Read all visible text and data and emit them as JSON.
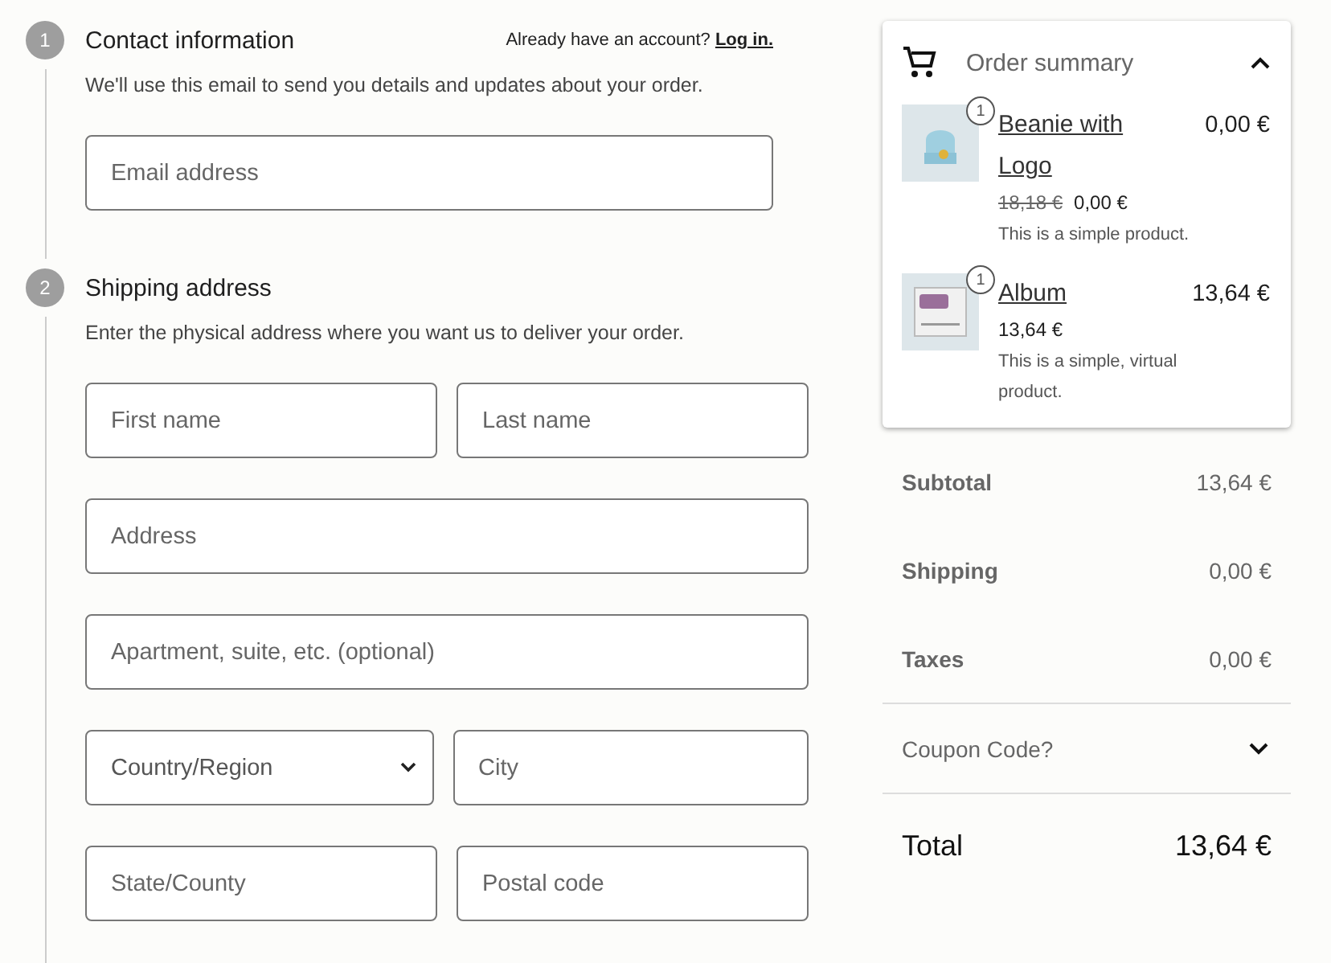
{
  "steps": [
    {
      "number": "1",
      "title": "Contact information",
      "aside_text": "Already have an account?",
      "aside_link": "Log in.",
      "description": "We'll use this email to send you details and updates about your order.",
      "rows": [
        [
          {
            "kind": "text",
            "placeholder": "Email address"
          }
        ]
      ]
    },
    {
      "number": "2",
      "title": "Shipping address",
      "description": "Enter the physical address where you want us to deliver your order.",
      "rows": [
        [
          {
            "kind": "text",
            "placeholder": "First name"
          },
          {
            "kind": "text",
            "placeholder": "Last name"
          }
        ],
        [
          {
            "kind": "text",
            "placeholder": "Address"
          }
        ],
        [
          {
            "kind": "text",
            "placeholder": "Apartment, suite, etc. (optional)"
          }
        ],
        [
          {
            "kind": "select",
            "placeholder": "Country/Region"
          },
          {
            "kind": "text",
            "placeholder": "City"
          }
        ],
        [
          {
            "kind": "text",
            "placeholder": "State/County"
          },
          {
            "kind": "text",
            "placeholder": "Postal code"
          }
        ]
      ]
    }
  ],
  "order_summary": {
    "title": "Order summary",
    "expanded": true,
    "items": [
      {
        "quantity": "1",
        "name": "Beanie with Logo",
        "total": "0,00 €",
        "regular_price": "18,18 €",
        "price": "0,00 €",
        "description": "This is a simple product."
      },
      {
        "quantity": "1",
        "name": "Album",
        "total": "13,64 €",
        "price": "13,64 €",
        "description": "This is a simple, virtual product."
      }
    ]
  },
  "totals": [
    {
      "label": "Subtotal",
      "value": "13,64 €"
    },
    {
      "label": "Shipping",
      "value": "0,00 €"
    },
    {
      "label": "Taxes",
      "value": "0,00 €"
    }
  ],
  "coupon": {
    "label": "Coupon Code?",
    "expanded": false
  },
  "total": {
    "label": "Total",
    "value": "13,64 €"
  }
}
